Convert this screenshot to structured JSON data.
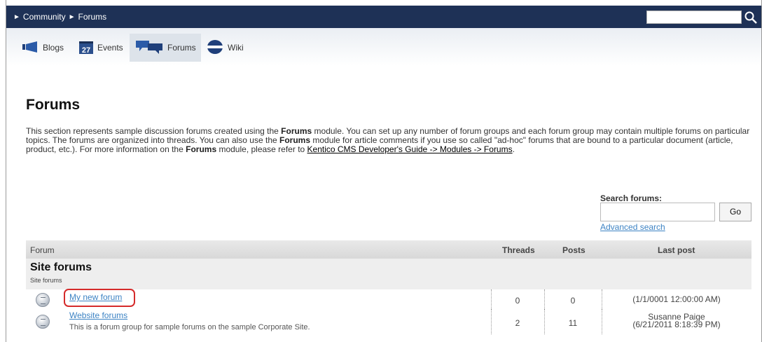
{
  "breadcrumb": {
    "items": [
      "Community",
      "Forums"
    ]
  },
  "nav": {
    "tabs": [
      {
        "label": "Blogs",
        "icon": "megaphone-icon"
      },
      {
        "label": "Events",
        "icon": "calendar-icon",
        "badge": "27"
      },
      {
        "label": "Forums",
        "icon": "chat-bubbles-icon"
      },
      {
        "label": "Wiki",
        "icon": "globe-icon"
      }
    ],
    "active": "Forums"
  },
  "page": {
    "title": "Forums",
    "intro": {
      "p1": "This section represents sample discussion forums created using the ",
      "b1": "Forums",
      "p2": " module. You can set up any number of forum groups and each forum group may contain multiple forums on particular topics. The forums are organized into threads. You can also use the ",
      "b2": "Forums",
      "p3": " module for article comments if you use so called \"ad-hoc\" forums that are bound to a particular document (article, product, etc.). For more information on the ",
      "b3": "Forums",
      "p4": " module, please refer to ",
      "link": "Kentico CMS Developer's Guide -> Modules -> Forums",
      "end": "."
    }
  },
  "search": {
    "label": "Search forums:",
    "value": "",
    "button": "Go",
    "advanced": "Advanced search"
  },
  "table": {
    "headers": {
      "forum": "Forum",
      "threads": "Threads",
      "posts": "Posts",
      "last_post": "Last post"
    },
    "group": {
      "title": "Site forums",
      "subtitle": "Site forums"
    },
    "rows": [
      {
        "name": "My new forum",
        "description": "",
        "threads": "0",
        "posts": "0",
        "last_post_user": "",
        "last_post_date": "(1/1/0001 12:00:00 AM)"
      },
      {
        "name": "Website forums",
        "description": "This is a forum group for sample forums on the sample Corporate Site.",
        "threads": "2",
        "posts": "11",
        "last_post_user": "Susanne Paige",
        "last_post_date": "(6/21/2011 8:18:39 PM)"
      }
    ]
  },
  "colors": {
    "topbar": "#1e3156",
    "link": "#3d83c4",
    "highlight": "#d52b2b"
  }
}
